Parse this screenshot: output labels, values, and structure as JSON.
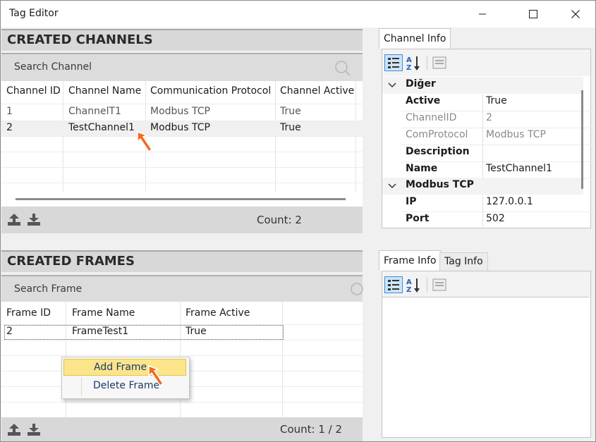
{
  "window": {
    "title": "Tag Editor"
  },
  "channels": {
    "header": "CREATED CHANNELS",
    "search_placeholder": "Search Channel",
    "columns": [
      "Channel ID",
      "Channel Name",
      "Communication Protocol",
      "Channel Active"
    ],
    "rows": [
      {
        "id": "1",
        "name": "ChannelT1",
        "protocol": "Modbus TCP",
        "active": "True"
      },
      {
        "id": "2",
        "name": "TestChannel1",
        "protocol": "Modbus TCP",
        "active": "True"
      }
    ],
    "count": "Count: 2"
  },
  "frames": {
    "header": "CREATED FRAMES",
    "search_placeholder": "Search Frame",
    "columns": [
      "Frame ID",
      "Frame Name",
      "Frame Active"
    ],
    "rows": [
      {
        "id": "2",
        "name": "FrameTest1",
        "active": "True"
      }
    ],
    "count": "Count: 1 / 2"
  },
  "context_menu": {
    "items": [
      "Add Frame",
      "Delete Frame"
    ]
  },
  "channel_info": {
    "tab": "Channel Info",
    "categories": [
      {
        "name": "Diğer",
        "properties": [
          {
            "name": "Active",
            "value": "True",
            "readonly": false
          },
          {
            "name": "ChannelID",
            "value": "2",
            "readonly": true
          },
          {
            "name": "ComProtocol",
            "value": "Modbus TCP",
            "readonly": true
          },
          {
            "name": "Description",
            "value": "",
            "readonly": false
          },
          {
            "name": "Name",
            "value": "TestChannel1",
            "readonly": false
          }
        ]
      },
      {
        "name": "Modbus TCP",
        "properties": [
          {
            "name": "IP",
            "value": "127.0.0.1",
            "readonly": false
          },
          {
            "name": "Port",
            "value": "502",
            "readonly": false
          }
        ]
      }
    ]
  },
  "frame_info": {
    "tabs": [
      "Frame Info",
      "Tag Info"
    ]
  },
  "colors": {
    "accent_arrow": "#f26b1d",
    "selected_row": "#f0f0f0",
    "menu_highlight": "#fbe58a"
  }
}
